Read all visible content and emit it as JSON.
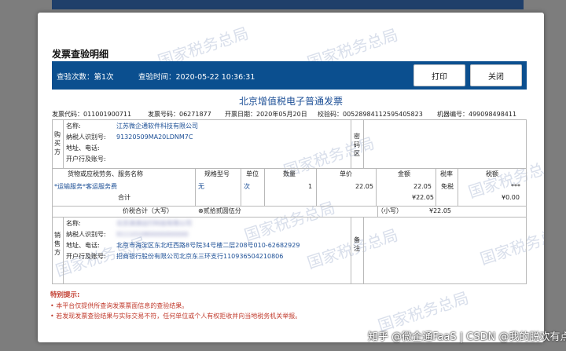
{
  "dialog": {
    "title": "发票查验明细",
    "check_count_label": "查验次数：第1次",
    "check_time_label": "查验时间：2020-05-22 10:36:31",
    "print_label": "打印",
    "close_label": "关闭"
  },
  "invoice": {
    "title": "北京增值税电子普通发票",
    "code": "发票代码：011001900711",
    "number": "发票号码：06271877",
    "date": "开票日期：2020年05月20日",
    "check_code": "校验码：00528984112595405823",
    "machine_no": "机器编号：499098498411",
    "buyer": {
      "side_label": "购买方",
      "name_label": "名称:",
      "name_value": "江苏微企通软件科技有限公司",
      "tax_label": "纳税人识别号:",
      "tax_value": "91320509MA20LDNM7C",
      "addr_label": "地址、电话:",
      "bank_label": "开户行及账号:",
      "password_area": "密码区"
    },
    "items": {
      "headers": [
        "货物或应税劳务、服务名称",
        "规格型号",
        "单位",
        "数量",
        "单价",
        "金额",
        "税率",
        "税额"
      ],
      "row": {
        "name": "*运输服务*客运服务费",
        "spec": "无",
        "unit": "次",
        "qty": "1",
        "price": "22.05",
        "amount": "22.05",
        "rate": "免税",
        "tax": "***"
      },
      "subtotal_label": "合计",
      "subtotal_amount": "¥22.05",
      "subtotal_tax": "¥0.00"
    },
    "total": {
      "label": "价税合计（大写）",
      "words": "⊗贰拾贰圆伍分",
      "small_label": "（小写）",
      "small_value": "¥22.05"
    },
    "seller": {
      "side_label": "销售方",
      "name_label": "名称:",
      "name_value": "北京滴滴出行科技有限公司",
      "tax_label": "纳税人识别号:",
      "tax_value": "911101080000000000",
      "addr_label": "地址、电话:",
      "addr_value": "北京市海淀区东北旺西路8号院34号楼二层208号010-62682929",
      "bank_label": "开户行及账号:",
      "bank_value": "招商银行股份有限公司北京东三环支行110936504210806",
      "remarks": "备注"
    }
  },
  "notice": {
    "title": "特别提示:",
    "line1": "• 本平台仅提供所查询发票票面信息的查验结果。",
    "line2": "• 若发现发票查验结果与实际交易不符，任何单位或个人有权拒收并向当地税务机关举报。"
  },
  "watermark": "国家税务总局",
  "footer_watermark": "知乎 @微企通FaaS | CSDN @我的脱欢有点不稳"
}
